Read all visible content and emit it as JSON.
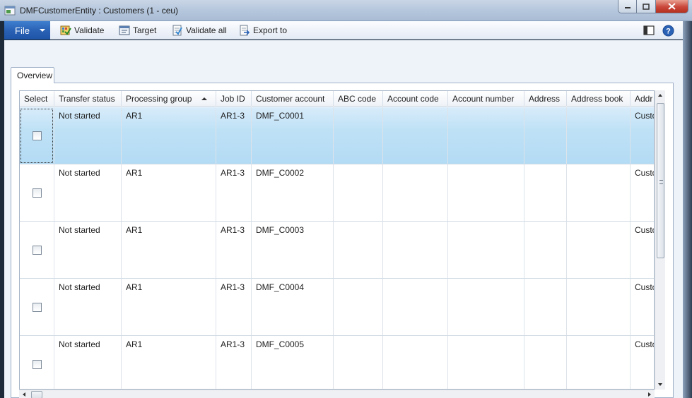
{
  "window": {
    "title": "DMFCustomerEntity : Customers (1 - ceu)"
  },
  "toolbar": {
    "file_label": "File",
    "validate_label": "Validate",
    "target_label": "Target",
    "validate_all_label": "Validate all",
    "export_to_label": "Export to"
  },
  "tabs": [
    {
      "label": "Overview",
      "active": true
    }
  ],
  "grid": {
    "columns": [
      "Select",
      "Transfer status",
      "Processing group",
      "Job ID",
      "Customer account",
      "ABC code",
      "Account code",
      "Account number",
      "Address",
      "Address book",
      "Addr"
    ],
    "sorted_column": "Processing group",
    "sort_direction": "ascending",
    "rows": [
      {
        "selected": true,
        "checked": false,
        "transfer_status": "Not started",
        "processing_group": "AR1",
        "job_id": "AR1-3",
        "customer_account": "DMF_C0001",
        "abc_code": "",
        "account_code": "",
        "account_number": "",
        "address": "",
        "address_book": "",
        "addr": "Custo"
      },
      {
        "selected": false,
        "checked": false,
        "transfer_status": "Not started",
        "processing_group": "AR1",
        "job_id": "AR1-3",
        "customer_account": "DMF_C0002",
        "abc_code": "",
        "account_code": "",
        "account_number": "",
        "address": "",
        "address_book": "",
        "addr": "Custo"
      },
      {
        "selected": false,
        "checked": false,
        "transfer_status": "Not started",
        "processing_group": "AR1",
        "job_id": "AR1-3",
        "customer_account": "DMF_C0003",
        "abc_code": "",
        "account_code": "",
        "account_number": "",
        "address": "",
        "address_book": "",
        "addr": "Custo"
      },
      {
        "selected": false,
        "checked": false,
        "transfer_status": "Not started",
        "processing_group": "AR1",
        "job_id": "AR1-3",
        "customer_account": "DMF_C0004",
        "abc_code": "",
        "account_code": "",
        "account_number": "",
        "address": "",
        "address_book": "",
        "addr": "Custo"
      },
      {
        "selected": false,
        "checked": false,
        "transfer_status": "Not started",
        "processing_group": "AR1",
        "job_id": "AR1-3",
        "customer_account": "DMF_C0005",
        "abc_code": "",
        "account_code": "",
        "account_number": "",
        "address": "",
        "address_book": "",
        "addr": "Custo"
      }
    ]
  },
  "colors": {
    "file_button": "#2a62b5",
    "selected_row": "#bfe1f6",
    "title_bar": "#b4c6dc",
    "close_button": "#c9463a"
  },
  "icons": [
    "app-icon",
    "validate-icon",
    "target-icon",
    "validate-all-icon",
    "export-to-icon",
    "layout-icon",
    "help-icon"
  ]
}
